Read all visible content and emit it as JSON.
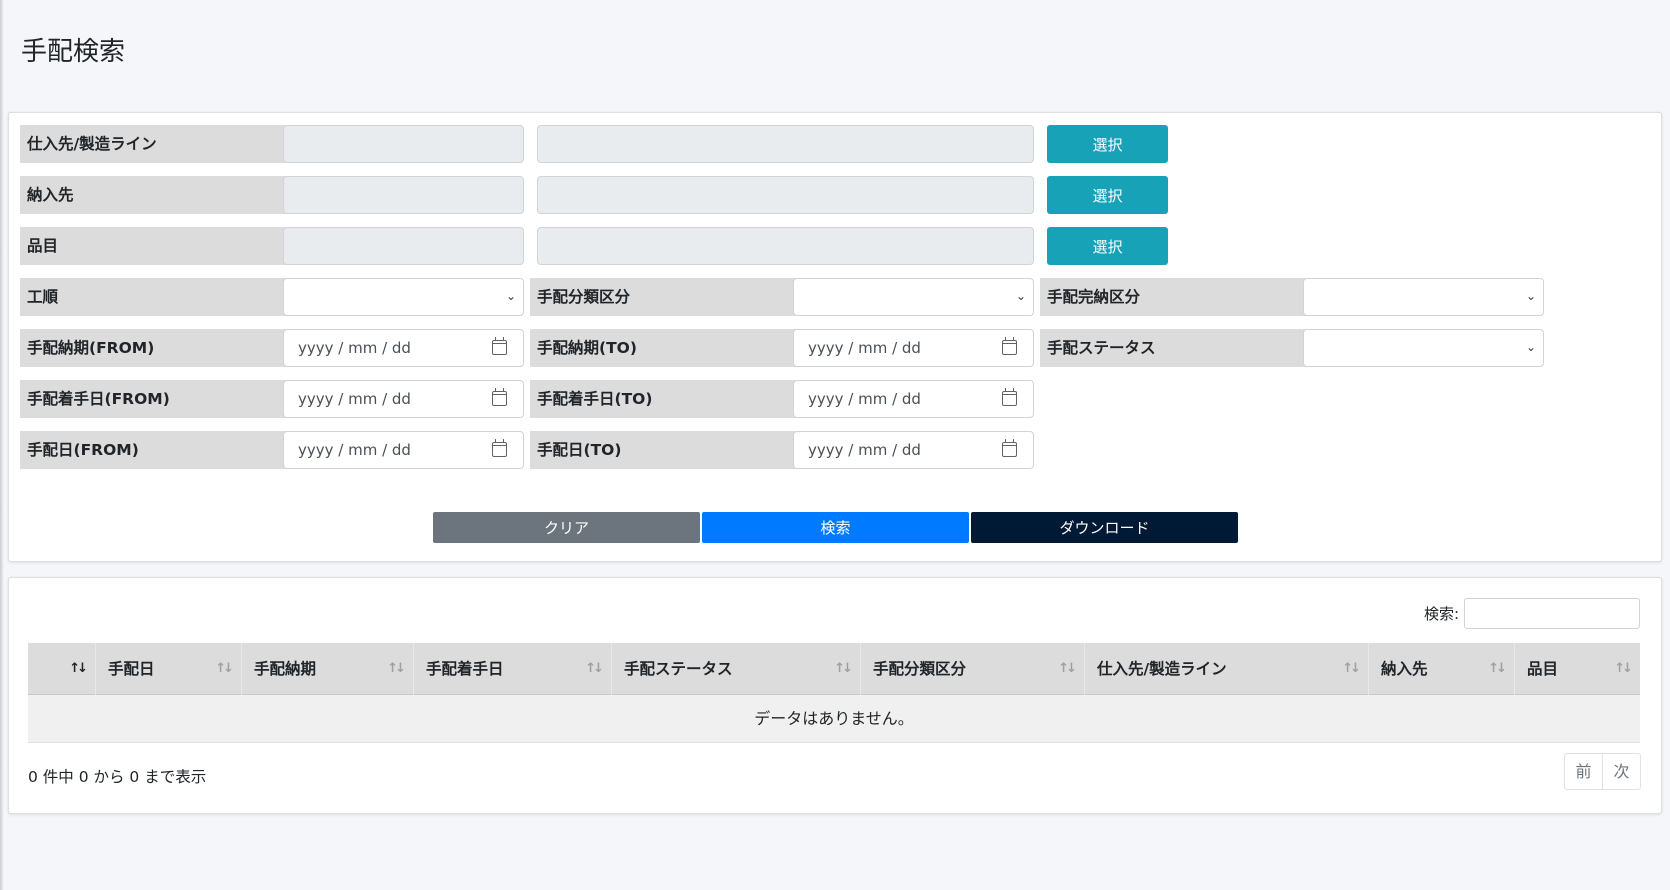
{
  "page": {
    "title": "手配検索"
  },
  "form": {
    "supplier_label": "仕入先/製造ライン",
    "delivery_label": "納入先",
    "item_label": "品目",
    "select_button": "選択",
    "process_label": "工順",
    "category_label": "手配分類区分",
    "completion_label": "手配完納区分",
    "due_from_label": "手配納期(FROM)",
    "due_to_label": "手配納期(TO)",
    "status_label": "手配ステータス",
    "start_from_label": "手配着手日(FROM)",
    "start_to_label": "手配着手日(TO)",
    "order_from_label": "手配日(FROM)",
    "order_to_label": "手配日(TO)",
    "date_placeholder": "yyyy / mm / dd",
    "clear_button": "クリア",
    "search_button": "検索",
    "download_button": "ダウンロード"
  },
  "table": {
    "search_label": "検索:",
    "columns": [
      "",
      "手配日",
      "手配納期",
      "手配着手日",
      "手配ステータス",
      "手配分類区分",
      "仕入先/製造ライン",
      "納入先",
      "品目"
    ],
    "empty_message": "データはありません。",
    "info": "0 件中 0 から 0 まで表示",
    "prev": "前",
    "next": "次"
  },
  "icons": {
    "sort": "sort-icon",
    "calendar": "calendar-icon",
    "dropdown": "chevron-down-icon"
  },
  "colors": {
    "select_button": "#17a2b8",
    "search_button": "#007bff",
    "clear_button": "#6c757d",
    "download_button": "#001a35",
    "label_bg": "#dcdcdc"
  }
}
